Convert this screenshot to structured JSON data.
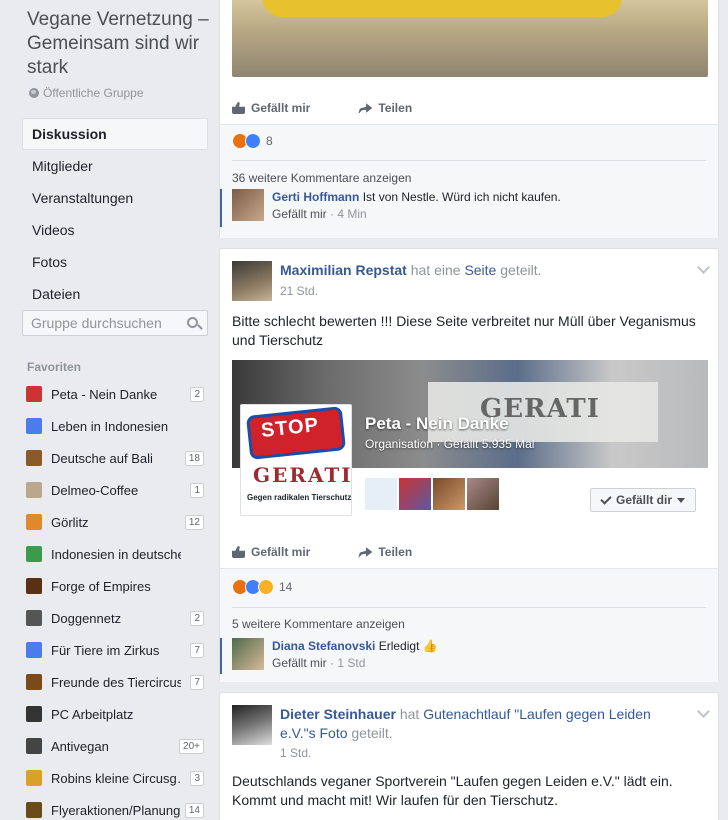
{
  "group": {
    "title": "Vegane Vernetzung – Gemeinsam sind wir stark",
    "privacy": "Öffentliche Gruppe"
  },
  "nav": {
    "items": [
      "Diskussion",
      "Mitglieder",
      "Veranstaltungen",
      "Videos",
      "Fotos",
      "Dateien"
    ],
    "active": "Diskussion"
  },
  "search": {
    "placeholder": "Gruppe durchsuchen"
  },
  "favorites": {
    "header": "Favoriten",
    "items": [
      {
        "label": "Peta - Nein Danke",
        "count": "2",
        "icon_color": "#c33"
      },
      {
        "label": "Leben in Indonesien",
        "count": "",
        "icon_color": "#4b7bec"
      },
      {
        "label": "Deutsche auf Bali",
        "count": "18",
        "icon_color": "#8b5a2b"
      },
      {
        "label": "Delmeo-Coffee",
        "count": "1",
        "icon_color": "#b9a88c"
      },
      {
        "label": "Görlitz",
        "count": "12",
        "icon_color": "#e0892b"
      },
      {
        "label": "Indonesien in deutschen…",
        "count": "",
        "icon_color": "#3a9b4a"
      },
      {
        "label": "Forge of Empires",
        "count": "",
        "icon_color": "#5a3015"
      },
      {
        "label": "Doggennetz",
        "count": "2",
        "icon_color": "#555"
      },
      {
        "label": "Für Tiere im Zirkus",
        "count": "7",
        "icon_color": "#4b7bec"
      },
      {
        "label": "Freunde des Tiercircus",
        "count": "7",
        "icon_color": "#7a4a1a"
      },
      {
        "label": "PC Arbeitplatz",
        "count": "",
        "icon_color": "#333"
      },
      {
        "label": "Antivegan",
        "count": "20+",
        "icon_color": "#444"
      },
      {
        "label": "Robins kleine Circusg…",
        "count": "3",
        "icon_color": "#d9a227"
      },
      {
        "label": "Flyeraktionen/Planung",
        "count": "14",
        "icon_color": "#6b4a1a"
      }
    ]
  },
  "post1": {
    "like_label": "Gefällt mir",
    "share_label": "Teilen",
    "reaction_count": "8",
    "more_comments": "36 weitere Kommentare anzeigen",
    "comment": {
      "name": "Gerti Hoffmann",
      "text": "Ist von Nestle. Würd ich nicht kaufen.",
      "like": "Gefällt mir",
      "time": "· 4 Min"
    }
  },
  "post2": {
    "author": "Maximilian Repstat",
    "action_pre": "hat eine",
    "action_link": "Seite",
    "action_post": "geteilt.",
    "time": "21 Std.",
    "text": "Bitte schlecht bewerten !!! Diese Seite verbreitet nur Müll über Veganismus und Tierschutz",
    "card": {
      "stop_text": "STOP",
      "brand": "GERATI",
      "brand_sub": "Gegen radikalen Tierschutz",
      "banner_text": "GERATI",
      "page_name": "Peta - Nein Danke",
      "page_meta": "Organisation · Gefällt 5.935 Mal",
      "liked_button": "Gefällt dir"
    },
    "like_label": "Gefällt mir",
    "share_label": "Teilen",
    "reaction_count": "14",
    "more_comments": "5 weitere Kommentare anzeigen",
    "comment": {
      "name": "Diana Stefanovski",
      "text": "Erledigt 👍",
      "like": "Gefällt mir",
      "time": "· 1 Std"
    }
  },
  "post3": {
    "author": "Dieter Steinhauer",
    "action_pre": "hat",
    "action_link": "Gutenachtlauf \"Laufen gegen Leiden e.V.\"s Foto",
    "action_post": "geteilt.",
    "time": "1 Std.",
    "text": "Deutschlands veganer Sportverein \"Laufen gegen Leiden e.V.\" lädt ein. Kommt und macht mit! Wir laufen für den Tierschutz."
  }
}
